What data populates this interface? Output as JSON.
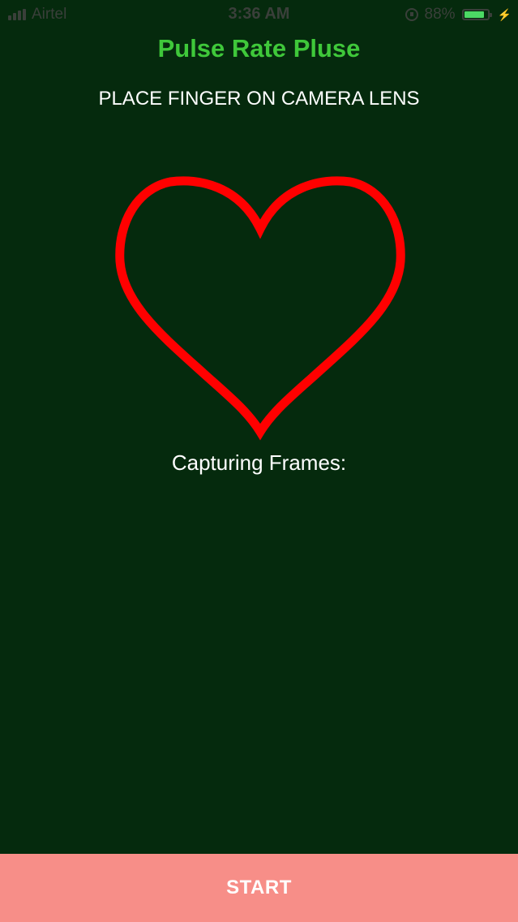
{
  "status_bar": {
    "carrier": "Airtel",
    "time": "3:36 AM",
    "battery_percent": "88%",
    "battery_level": 0.88,
    "battery_color": "#4cd964",
    "icons": [
      "signal-icon",
      "orientation-lock-icon",
      "battery-icon",
      "charging-bolt-icon"
    ]
  },
  "header": {
    "title": "Pulse Rate Pluse",
    "title_color": "#3fc83a"
  },
  "main": {
    "instruction": "PLACE FINGER ON CAMERA LENS",
    "heart_icon": "heart-outline-icon",
    "heart_color": "#ff0000",
    "capture_label": "Capturing Frames:"
  },
  "footer": {
    "start_label": "START",
    "start_color": "#f78e88"
  },
  "background_color": "#052a0d"
}
